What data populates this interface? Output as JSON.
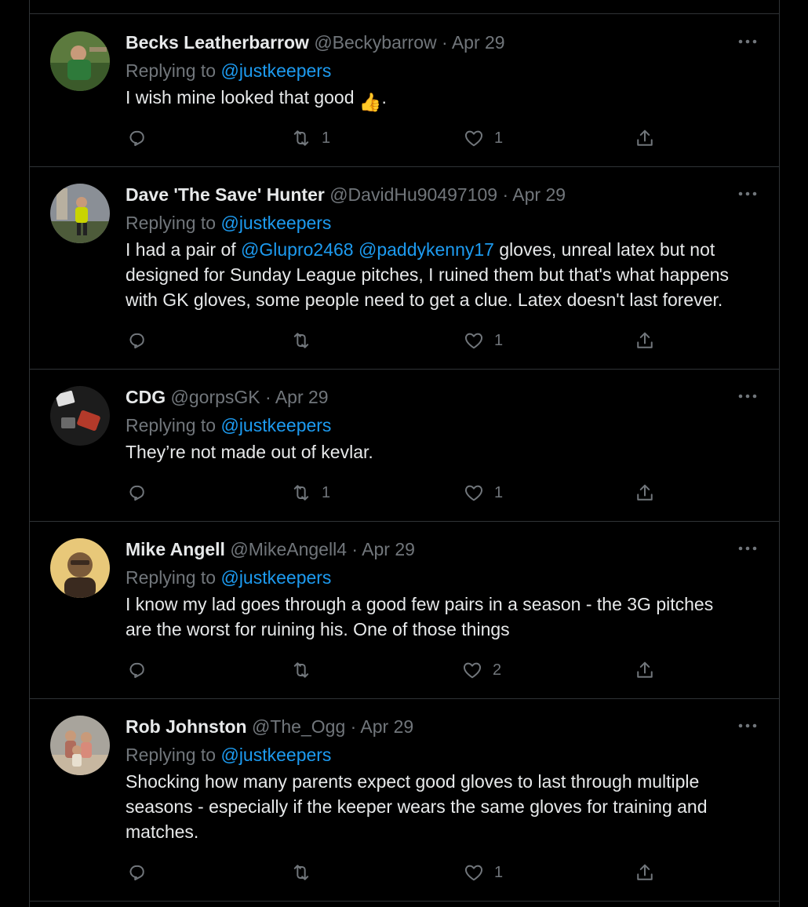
{
  "tweets": [
    {
      "name": "Becks Leatherbarrow",
      "handle": "@Beckybarrow",
      "sep": "·",
      "date": "Apr 29",
      "reply_prefix": "Replying to",
      "reply_to": "@justkeepers",
      "text_parts": [
        "I wish mine looked that good ",
        "👍",
        "."
      ],
      "retweets": "1",
      "likes": "1",
      "avatar_colors": [
        "#3b5a2a",
        "#6f8f4a",
        "#2e7a3a"
      ]
    },
    {
      "name": "Dave 'The Save' Hunter",
      "handle": "@DavidHu90497109",
      "sep": "·",
      "date": "Apr 29",
      "reply_prefix": "Replying to",
      "reply_to": "@justkeepers",
      "text_before": "I had a pair of ",
      "mention1": "@Glupro2468",
      "text_mid": " ",
      "mention2": "@paddykenny17",
      "text_after_line1": " gloves, unreal latex but not",
      "line2": "designed for Sunday League pitches, I ruined them but that's what happens",
      "line3": "with GK gloves, some people need to get a clue. Latex doesn't last forever.",
      "retweets": "",
      "likes": "1",
      "avatar_colors": [
        "#7a7f86",
        "#c9d400",
        "#4d5b3a"
      ]
    },
    {
      "name": "CDG",
      "handle": "@gorpsGK",
      "sep": "·",
      "date": "Apr 29",
      "reply_prefix": "Replying to",
      "reply_to": "@justkeepers",
      "text": "They’re not made out of kevlar.",
      "retweets": "1",
      "likes": "1",
      "avatar_colors": [
        "#2a2a2a",
        "#b43a2a",
        "#e0e0e0"
      ]
    },
    {
      "name": "Mike Angell",
      "handle": "@MikeAngell4",
      "sep": "·",
      "date": "Apr 29",
      "reply_prefix": "Replying to",
      "reply_to": "@justkeepers",
      "line1": "I know my lad goes through a good few pairs in a season - the 3G pitches",
      "line2": "are the worst for ruining his. One of those things",
      "retweets": "",
      "likes": "2",
      "avatar_colors": [
        "#e8c879",
        "#7a5a3a",
        "#3a2a1f"
      ]
    },
    {
      "name": "Rob Johnston",
      "handle": "@The_Ogg",
      "sep": "·",
      "date": "Apr 29",
      "reply_prefix": "Replying to",
      "reply_to": "@justkeepers",
      "line1": "Shocking how many parents expect good gloves to last through multiple",
      "line2": "seasons - especially if the keeper wears the same gloves for training and",
      "line3": "matches.",
      "retweets": "",
      "likes": "1",
      "avatar_colors": [
        "#c7b7a0",
        "#b06c5c",
        "#8a8a8a"
      ]
    }
  ],
  "icons": {
    "more": "more-horizontal-icon",
    "reply": "reply-icon",
    "retweet": "retweet-icon",
    "like": "heart-icon",
    "share": "share-icon"
  },
  "colors": {
    "background": "#000000",
    "text": "#e7e9ea",
    "muted": "#71767b",
    "link": "#1d9bf0",
    "border": "#2f3336"
  }
}
